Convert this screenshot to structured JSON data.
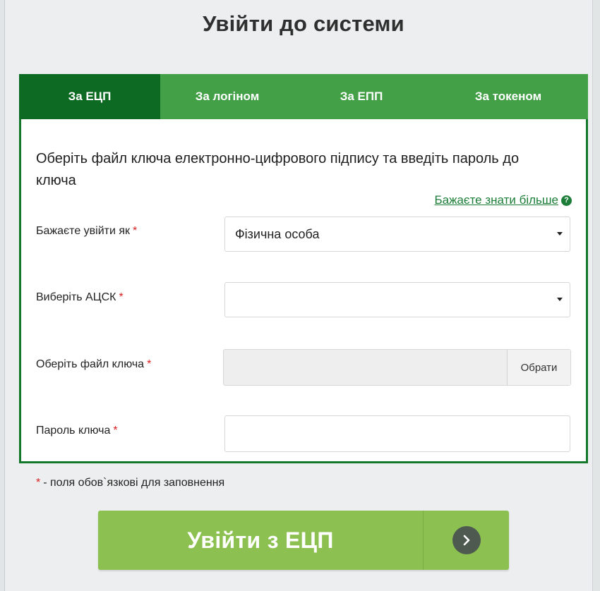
{
  "page": {
    "title": "Увійти до системи"
  },
  "tabs": [
    {
      "label": "За ЕЦП",
      "active": true
    },
    {
      "label": "За логіном",
      "active": false
    },
    {
      "label": "За ЕПП",
      "active": false
    },
    {
      "label": "За токеном",
      "active": false
    }
  ],
  "form": {
    "intro": "Оберіть файл ключа електронно-цифрового підпису та введіть пароль до ключа",
    "more_link": "Бажаєте знати більше",
    "help_icon_glyph": "?",
    "required_mark": "*",
    "fields": {
      "login_as": {
        "label": "Бажаєте увійти як",
        "value": "Фізична особа"
      },
      "acsk": {
        "label": "Виберіть АЦСК",
        "value": ""
      },
      "key_file": {
        "label": "Оберіть файл ключа",
        "value": "",
        "button": "Обрати"
      },
      "key_password": {
        "label": "Пароль ключа",
        "value": ""
      }
    },
    "required_note": "- поля обов`язкові для заповнення"
  },
  "login_button": {
    "label": "Увійти з ЕЦП",
    "icon": "chevron-right-icon"
  },
  "colors": {
    "tab_active": "#0c6a22",
    "tab_bar": "#43a047",
    "panel_border": "#14782b",
    "button": "#8cc152",
    "link": "#1c7d38",
    "required": "#d81f1f"
  }
}
